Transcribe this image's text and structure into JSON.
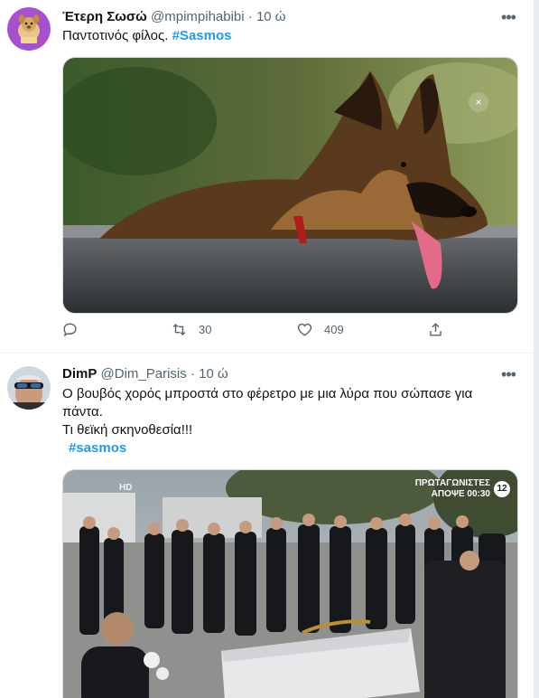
{
  "tweets": [
    {
      "display_name": "Έτερη Σωσώ",
      "handle": "@mpimpihabibi",
      "separator": "·",
      "time": "10 ώ",
      "text": "Παντοτινός φίλος.",
      "hashtag": "#Sasmos",
      "media_close": "×",
      "reply_count": "",
      "retweet_count": "30",
      "like_count": "409"
    },
    {
      "display_name": "DimP",
      "handle": "@Dim_Parisis",
      "separator": "·",
      "time": "10 ώ",
      "text_line1": "Ο βουβός χορός μπροστά στο φέρετρο με μια λύρα που σώπασε για",
      "text_line2": "πάντα.",
      "text_line3": "Τι θεϊκή σκηνοθεσία!!!",
      "hashtag": "#sasmos",
      "media_overlay": {
        "tv_line1": "ΠΡΩΤΑΓΩΝΙΣΤΕΣ",
        "tv_line2": "ΑΠΟΨΕ 00:30",
        "tv_rating": "12",
        "hd_label": "HD"
      }
    }
  ],
  "icons": {
    "more": "more-icon",
    "reply": "reply-icon",
    "retweet": "retweet-icon",
    "like": "heart-icon",
    "share": "share-icon"
  },
  "colors": {
    "accent": "#1d9bf0",
    "secondary_text": "#536471",
    "border": "#cfd9de"
  }
}
